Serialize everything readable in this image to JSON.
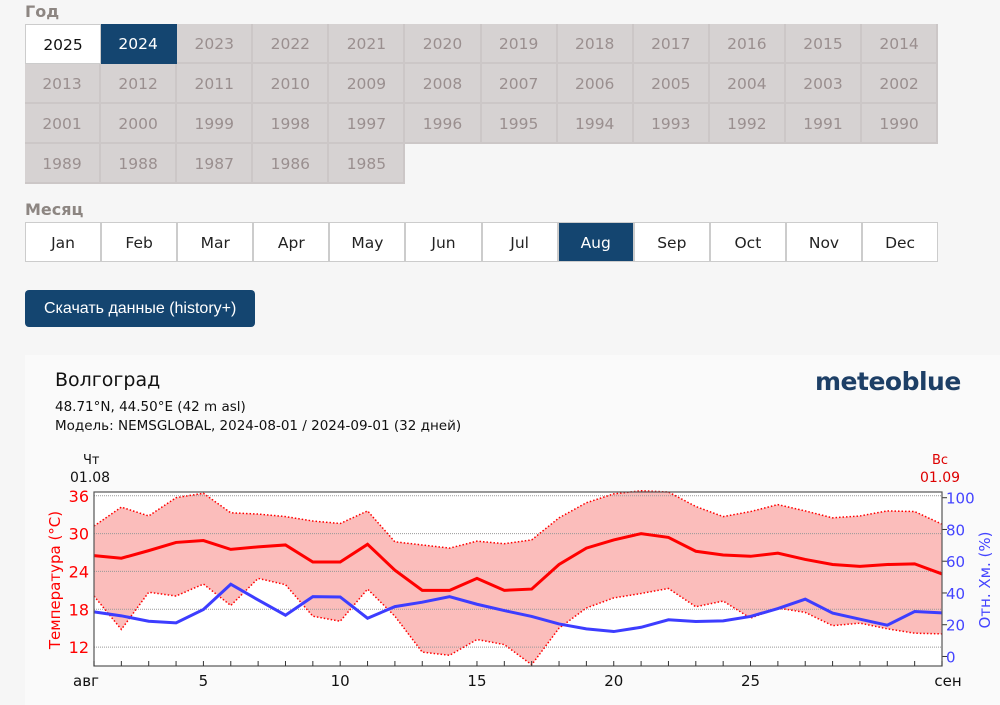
{
  "year_label": "Год",
  "years": [
    "2025",
    "2024",
    "2023",
    "2022",
    "2021",
    "2020",
    "2019",
    "2018",
    "2017",
    "2016",
    "2015",
    "2014",
    "2013",
    "2012",
    "2011",
    "2010",
    "2009",
    "2008",
    "2007",
    "2006",
    "2005",
    "2004",
    "2003",
    "2002",
    "2001",
    "2000",
    "1999",
    "1998",
    "1997",
    "1996",
    "1995",
    "1994",
    "1993",
    "1992",
    "1991",
    "1990",
    "1989",
    "1988",
    "1987",
    "1986",
    "1985"
  ],
  "selected_year": "2024",
  "month_label": "Месяц",
  "months": [
    "Jan",
    "Feb",
    "Mar",
    "Apr",
    "May",
    "Jun",
    "Jul",
    "Aug",
    "Sep",
    "Oct",
    "Nov",
    "Dec"
  ],
  "selected_month": "Aug",
  "download_label": "Скачать данные (history+)",
  "chart": {
    "city": "Волгоград",
    "coords": "48.71°N, 44.50°E (42 m asl)",
    "model": "Модель: NEMSGLOBAL, 2024-08-01 / 2024-09-01 (32 дней)",
    "logo": "meteoblue",
    "start_day": "Чт",
    "start_date": "01.08",
    "end_day": "Вс",
    "end_date": "01.09"
  },
  "chart_data": {
    "type": "line",
    "x": [
      1,
      2,
      3,
      4,
      5,
      6,
      7,
      8,
      9,
      10,
      11,
      12,
      13,
      14,
      15,
      16,
      17,
      18,
      19,
      20,
      21,
      22,
      23,
      24,
      25,
      26,
      27,
      28,
      29,
      30,
      31,
      32
    ],
    "xtick_labels": [
      {
        "day": 1,
        "label": "авг"
      },
      {
        "day": 5,
        "label": "5"
      },
      {
        "day": 10,
        "label": "10"
      },
      {
        "day": 15,
        "label": "15"
      },
      {
        "day": 20,
        "label": "20"
      },
      {
        "day": 25,
        "label": "25"
      },
      {
        "day": 32,
        "label": "сен"
      }
    ],
    "ylabel": "Температура (°C)",
    "ylim": [
      9,
      36.6
    ],
    "yticks": [
      "12",
      "18",
      "24",
      "30",
      "36"
    ],
    "y2label": "Отн. Хм. (%)",
    "y2lim": [
      -6,
      103.6
    ],
    "y2ticks": [
      "0",
      "20",
      "40",
      "60",
      "80",
      "100"
    ],
    "grid": true,
    "colors": {
      "temp": "#ff0000",
      "band": "#fbbdbb",
      "humidity": "#3d3dff"
    },
    "series": [
      {
        "key": "temp_mean",
        "values": [
          26.5,
          26.1,
          27.3,
          28.6,
          28.9,
          27.5,
          27.9,
          28.2,
          25.5,
          25.5,
          28.3,
          24.2,
          21.0,
          21.0,
          22.9,
          21.0,
          21.2,
          25.1,
          27.7,
          29.0,
          30.0,
          29.4,
          27.2,
          26.6,
          26.4,
          26.9,
          25.9,
          25.1,
          24.8,
          25.1,
          25.2,
          23.6
        ]
      },
      {
        "key": "temp_max",
        "values": [
          31.2,
          34.2,
          32.8,
          35.7,
          36.4,
          33.3,
          33.1,
          32.7,
          32.0,
          31.6,
          33.6,
          28.7,
          28.2,
          27.7,
          28.8,
          28.4,
          29.0,
          32.5,
          34.9,
          36.3,
          36.8,
          36.6,
          34.3,
          32.7,
          33.5,
          34.6,
          33.6,
          32.5,
          32.8,
          33.6,
          33.5,
          31.5
        ]
      },
      {
        "key": "temp_min",
        "values": [
          20.1,
          14.8,
          20.7,
          20.1,
          22.0,
          18.6,
          22.9,
          21.9,
          16.9,
          16.1,
          21.2,
          16.9,
          11.2,
          10.7,
          13.2,
          12.4,
          9.2,
          15.0,
          18.2,
          19.8,
          20.5,
          21.3,
          18.4,
          19.3,
          16.6,
          18.2,
          17.5,
          15.4,
          15.8,
          14.9,
          14.2,
          14.1
        ]
      },
      {
        "key": "humidity",
        "values": [
          28.1,
          25.6,
          22.2,
          21.2,
          29.6,
          45.5,
          35.6,
          26.0,
          37.7,
          37.5,
          24.1,
          31.4,
          34.2,
          37.7,
          32.9,
          28.9,
          25.2,
          20.5,
          17.4,
          15.7,
          18.4,
          23.1,
          22.0,
          22.4,
          25.2,
          30.2,
          36.1,
          27.3,
          23.5,
          19.7,
          28.3,
          27.5
        ]
      }
    ]
  }
}
